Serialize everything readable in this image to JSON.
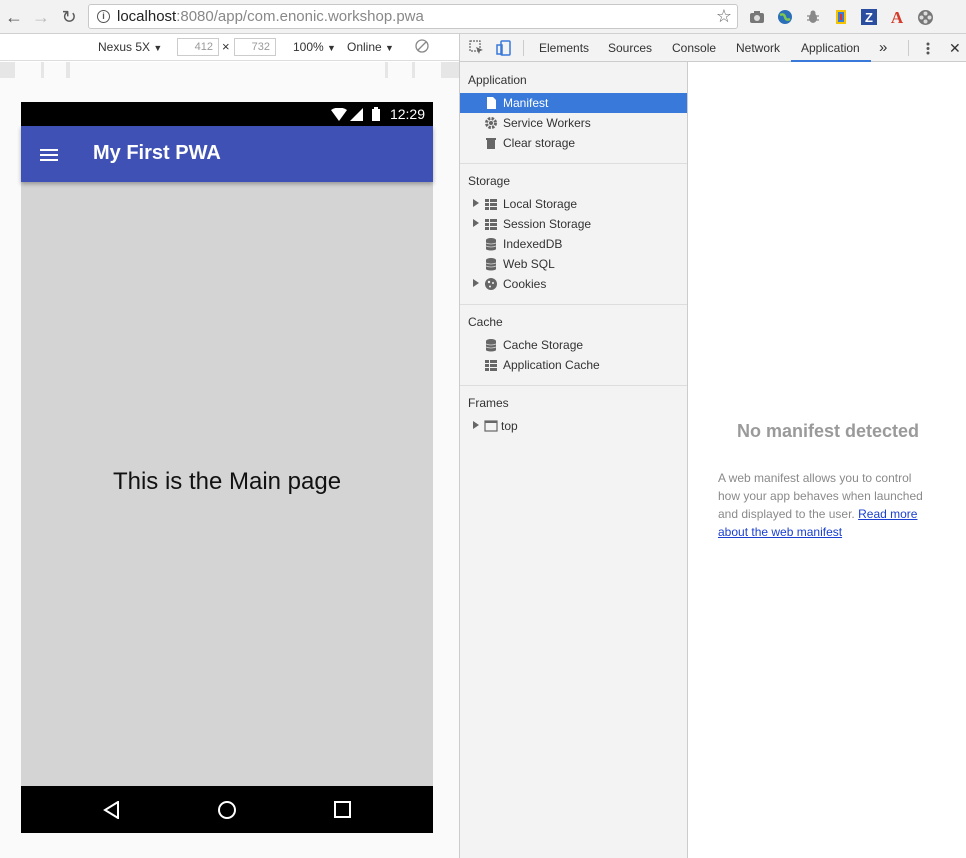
{
  "browser": {
    "url_host": "localhost",
    "url_rest": ":8080/app/com.enonic.workshop.pwa",
    "nav": {
      "back": "←",
      "forward": "→",
      "reload": "↻"
    },
    "star_icon": "☆",
    "extensions": [
      "camera-icon",
      "globe-icon",
      "bug-icon",
      "extension-icon",
      "z-icon",
      "a-icon",
      "film-icon"
    ]
  },
  "device_toolbar": {
    "device": "Nexus 5X",
    "width": "412",
    "height": "732",
    "times": "×",
    "zoom": "100%",
    "network": "Online"
  },
  "phone": {
    "time": "12:29",
    "app_title": "My First PWA",
    "main_text": "This is the Main page"
  },
  "devtools": {
    "tabs": [
      "Elements",
      "Sources",
      "Console",
      "Network",
      "Application"
    ],
    "more": "»",
    "close": "✕",
    "sections": {
      "application": {
        "title": "Application",
        "items": [
          "Manifest",
          "Service Workers",
          "Clear storage"
        ]
      },
      "storage": {
        "title": "Storage",
        "items": [
          "Local Storage",
          "Session Storage",
          "IndexedDB",
          "Web SQL",
          "Cookies"
        ]
      },
      "cache": {
        "title": "Cache",
        "items": [
          "Cache Storage",
          "Application Cache"
        ]
      },
      "frames": {
        "title": "Frames",
        "items": [
          "top"
        ]
      }
    },
    "panel": {
      "heading": "No manifest detected",
      "description": "A web manifest allows you to control how your app behaves when launched and displayed to the user.",
      "link": "Read more about the web manifest"
    }
  },
  "colors": {
    "appbar": "#3f51b5",
    "selected": "#3879d9",
    "link": "#1a3fd0"
  }
}
